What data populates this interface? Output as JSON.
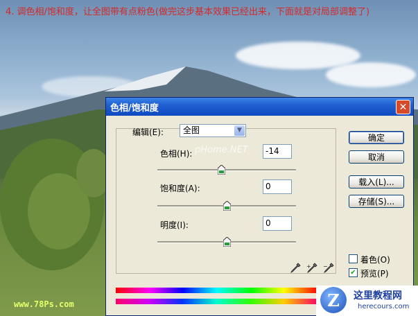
{
  "caption": "4. 调色相/饱和度，让全图带有点粉色(做完这步基本效果已经出来，下面就是对局部调整了)",
  "watermark": "www.78Ps.com",
  "dialog": {
    "title": "色相/饱和度",
    "close_glyph": "✕",
    "edit_label": "编辑(E):",
    "edit_value": "全图",
    "ghost_text": "pHome.NET",
    "hue": {
      "label": "色相(H):",
      "value": "-14",
      "level": -14,
      "min": -180,
      "max": 180
    },
    "saturation": {
      "label": "饱和度(A):",
      "value": "0",
      "level": 0,
      "min": -100,
      "max": 100
    },
    "lightness": {
      "label": "明度(I):",
      "value": "0",
      "level": 0,
      "min": -100,
      "max": 100
    },
    "buttons": {
      "ok": "确定",
      "cancel": "取消",
      "load": "载入(L)...",
      "save": "存储(S)..."
    },
    "colorize": {
      "label": "着色(O)",
      "checked": false
    },
    "preview": {
      "label": "预览(P)",
      "checked": true,
      "check_glyph": "✔"
    }
  },
  "logo": {
    "glyph": "Z",
    "name": "这里教程网",
    "url": "herecours.com"
  }
}
